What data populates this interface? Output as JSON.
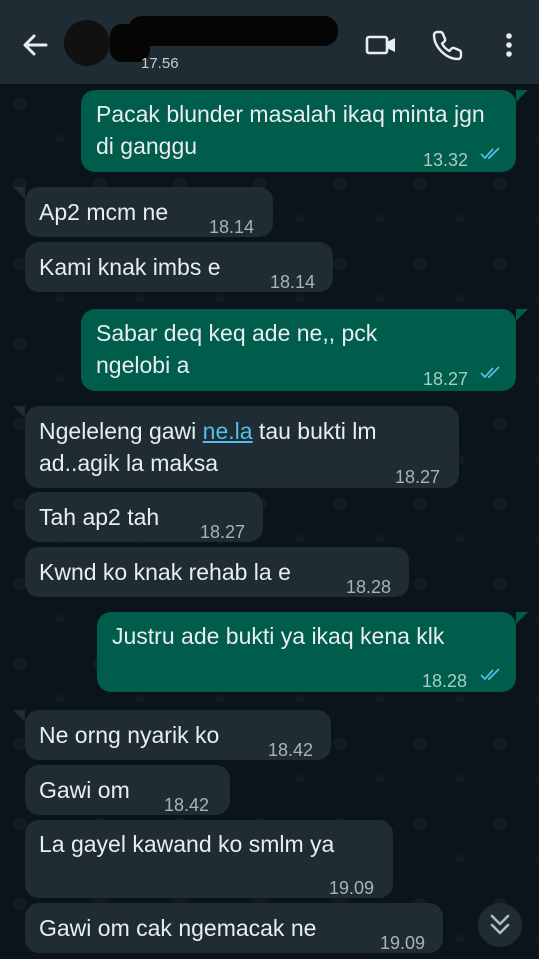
{
  "header": {
    "last_seen": "17.56"
  },
  "messages": [
    {
      "dir": "out",
      "text": "Pacak blunder masalah ikaq minta jgn di ganggu",
      "time": "13.32"
    },
    {
      "dir": "in",
      "text": "Ap2 mcm ne",
      "time": "18.14"
    },
    {
      "dir": "in",
      "text": "Kami knak imbs e",
      "time": "18.14"
    },
    {
      "dir": "out",
      "text": "Sabar deq keq ade ne,, pck ngelobi a",
      "time": "18.27"
    },
    {
      "dir": "in",
      "text_before": "Ngeleleng gawi ",
      "link": "ne.la",
      "text_after": " tau bukti lm ad..agik la maksa",
      "time": "18.27"
    },
    {
      "dir": "in",
      "text": "Tah ap2 tah",
      "time": "18.27"
    },
    {
      "dir": "in",
      "text": "Kwnd ko knak rehab la e",
      "time": "18.28"
    },
    {
      "dir": "out",
      "text": "Justru ade bukti ya ikaq kena klk",
      "time": "18.28"
    },
    {
      "dir": "in",
      "text": "Ne orng nyarik ko",
      "time": "18.42"
    },
    {
      "dir": "in",
      "text": "Gawi om",
      "time": "18.42"
    },
    {
      "dir": "in",
      "text": "La gayel kawand ko smlm ya",
      "time": "19.09"
    },
    {
      "dir": "in",
      "text": "Gawi om cak ngemacak ne",
      "time": "19.09"
    }
  ],
  "colors": {
    "header_bg": "#1f2c33",
    "chat_bg": "#0b141a",
    "incoming_bubble": "#202c33",
    "outgoing_bubble": "#005c4b",
    "read_ticks": "#53bdeb"
  },
  "icons": [
    "back-arrow-icon",
    "video-call-icon",
    "phone-icon",
    "more-vert-icon",
    "double-check-icon",
    "scroll-down-icon"
  ]
}
